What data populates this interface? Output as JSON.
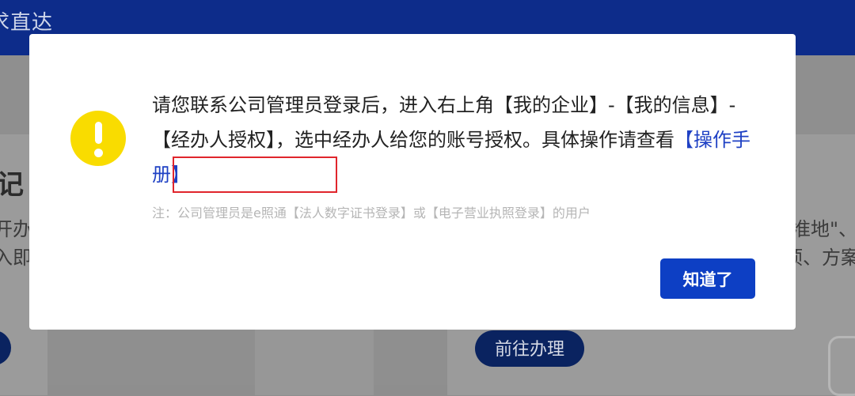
{
  "background": {
    "header_title": "求直达",
    "heading_fragment": "记",
    "left_text_1": "开办",
    "left_text_2": "入即",
    "right_text_1": "准地\"、",
    "right_text_2": "顷、方案",
    "go_button_label": "前往办理"
  },
  "modal": {
    "message_prefix": "请您联系公司管理员登录后，进入右上角【我的企业】-【我的信息】-【经办人授权】，选中经办人给您的账号授权。具体操作请查看",
    "manual_link_label": "【操作手册】",
    "note": "注：公司管理员是e照通【法人数字证书登录】或【电子营业执照登录】的用户",
    "ok_button_label": "知道了",
    "icon": "warning-exclamation-icon"
  },
  "colors": {
    "accent": "#0d3fc4",
    "link": "#1f41c4",
    "warning": "#f9dc00",
    "highlight": "#e0252c",
    "header": "#0d2c8a"
  }
}
